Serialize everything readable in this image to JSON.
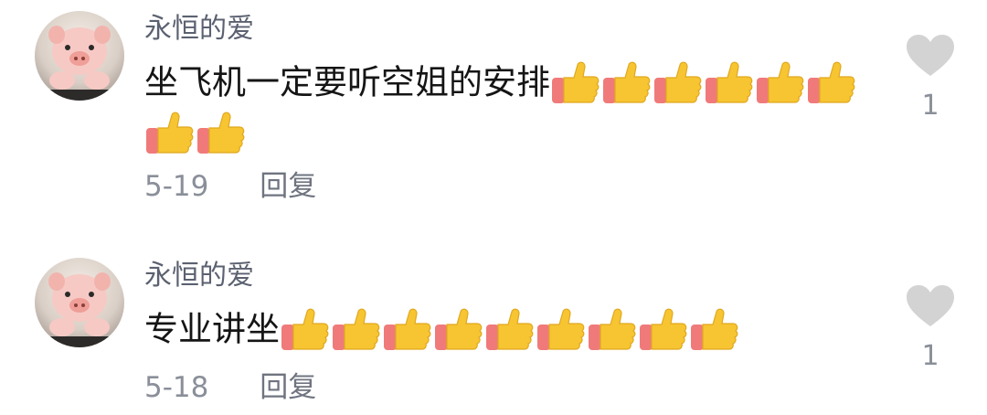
{
  "comments": [
    {
      "username": "永恒的爱",
      "text": "坐飞机一定要听空姐的安排",
      "emoji_icon": "thumbs-up-emoji",
      "emoji_count": 8,
      "date": "5-19",
      "reply_label": "回复",
      "like_count": "1"
    },
    {
      "username": "永恒的爱",
      "text": "专业讲坐",
      "emoji_icon": "thumbs-up-emoji",
      "emoji_count": 9,
      "date": "5-18",
      "reply_label": "回复",
      "like_count": "1"
    }
  ],
  "colors": {
    "username": "#5b6170",
    "meta": "#8a8f99",
    "heart": "#d3d3d3",
    "thumb": "#f7c531",
    "cuff": "#f07a7a"
  }
}
